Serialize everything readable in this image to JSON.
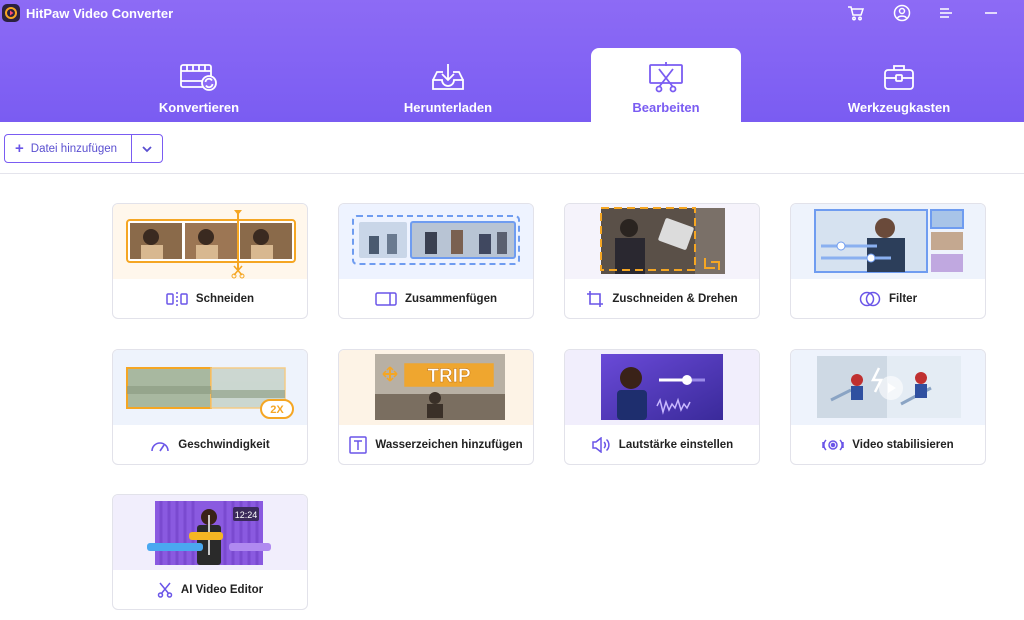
{
  "app": {
    "title": "HitPaw Video Converter"
  },
  "colors": {
    "accent": "#7a5cf2",
    "header": "#8d6bf5",
    "orange": "#f5a623"
  },
  "window_controls": [
    "cart-icon",
    "account-icon",
    "menu-icon",
    "minimize-icon"
  ],
  "tabs": [
    {
      "label": "Konvertieren",
      "icon": "convert-film-icon",
      "active": false
    },
    {
      "label": "Herunterladen",
      "icon": "download-tray-icon",
      "active": false
    },
    {
      "label": "Bearbeiten",
      "icon": "edit-scissors-icon",
      "active": true
    },
    {
      "label": "Werkzeugkasten",
      "icon": "toolbox-icon",
      "active": false
    }
  ],
  "toolbar": {
    "add_file_label": "Datei hinzufügen"
  },
  "tools": [
    {
      "label": "Schneiden",
      "icon": "split-icon"
    },
    {
      "label": "Zusammenfügen",
      "icon": "merge-icon"
    },
    {
      "label": "Zuschneiden & Drehen",
      "icon": "crop-icon"
    },
    {
      "label": "Filter",
      "icon": "filter-icon"
    },
    {
      "label": "Geschwindigkeit",
      "icon": "speed-icon",
      "badge": "2X"
    },
    {
      "label": "Wasserzeichen hinzufügen",
      "icon": "text-watermark-icon",
      "badge": "TRIP"
    },
    {
      "label": "Lautstärke einstellen",
      "icon": "volume-icon"
    },
    {
      "label": "Video stabilisieren",
      "icon": "stabilize-icon"
    },
    {
      "label": "AI Video Editor",
      "icon": "ai-scissors-icon",
      "badge": "12:24"
    }
  ]
}
